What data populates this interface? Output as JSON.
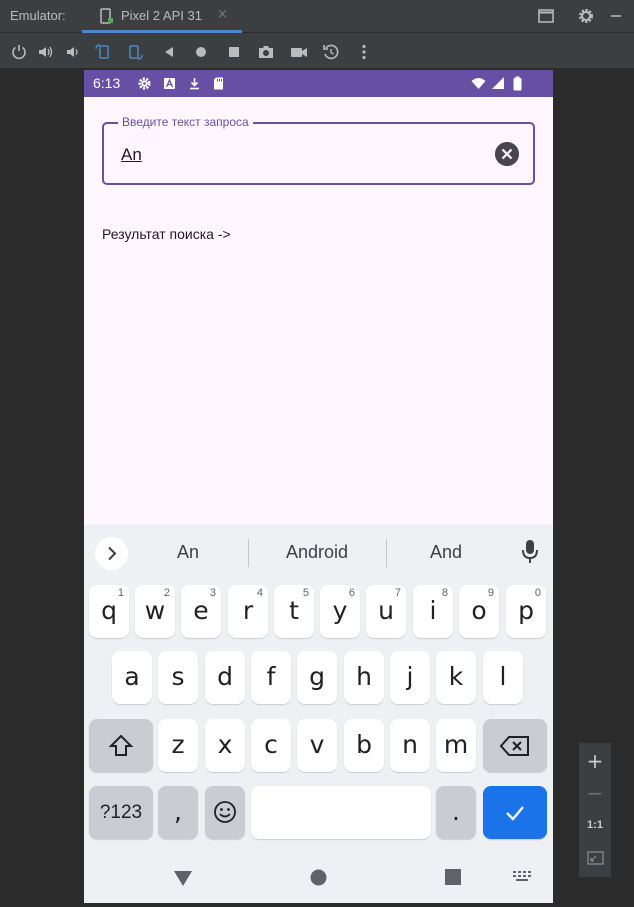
{
  "emulator": {
    "title": "Emulator:",
    "tab_label": "Pixel 2 API 31",
    "tab_close": "×",
    "accent": "#4a88c7"
  },
  "toolbar_icons": [
    "power-icon",
    "volume-up-icon",
    "volume-down-icon",
    "rotate-left-icon",
    "rotate-right-icon",
    "back-icon",
    "home-icon",
    "overview-icon",
    "camera-icon",
    "video-icon",
    "snapshot-icon",
    "more-icon"
  ],
  "device": {
    "status": {
      "time": "6:13",
      "bg_color": "#6750a4"
    },
    "search": {
      "label": "Введите текст запроса",
      "value": "An"
    },
    "result_text": "Результат поиска ->"
  },
  "keyboard": {
    "suggestions": [
      "An",
      "Android",
      "And"
    ],
    "row1": [
      {
        "key": "q",
        "hint": "1"
      },
      {
        "key": "w",
        "hint": "2"
      },
      {
        "key": "e",
        "hint": "3"
      },
      {
        "key": "r",
        "hint": "4"
      },
      {
        "key": "t",
        "hint": "5"
      },
      {
        "key": "y",
        "hint": "6"
      },
      {
        "key": "u",
        "hint": "7"
      },
      {
        "key": "i",
        "hint": "8"
      },
      {
        "key": "o",
        "hint": "9"
      },
      {
        "key": "p",
        "hint": "0"
      }
    ],
    "row2": [
      "a",
      "s",
      "d",
      "f",
      "g",
      "h",
      "j",
      "k",
      "l"
    ],
    "row3": [
      "z",
      "x",
      "c",
      "v",
      "b",
      "n",
      "m"
    ],
    "symbols_label": "?123",
    "comma": ",",
    "period": ".",
    "action_color": "#1a73e8"
  },
  "zoom": {
    "plus": "+",
    "minus": "−",
    "one_to_one": "1:1"
  }
}
